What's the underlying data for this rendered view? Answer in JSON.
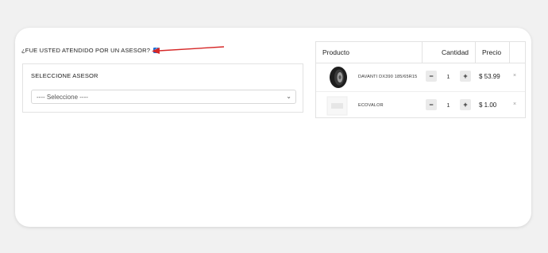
{
  "question": {
    "label": "¿FUE USTED ATENDIDO POR UN ASESOR?",
    "checked": true
  },
  "advisor": {
    "label": "SELECCIONE ASESOR",
    "select_value": "---- Seleccione ----"
  },
  "cart": {
    "headers": {
      "product": "Producto",
      "quantity": "Cantidad",
      "price": "Precio"
    },
    "items": [
      {
        "name": "DAVANTI DX390 185/65R15",
        "quantity": "1",
        "price": "$ 53.99",
        "minus": "−",
        "plus": "+",
        "remove": "×",
        "thumb_icon": "tire-icon"
      },
      {
        "name": "ECOVALOR",
        "quantity": "1",
        "price": "$ 1.00",
        "minus": "−",
        "plus": "+",
        "remove": "×",
        "thumb_icon": "product-placeholder-icon"
      }
    ]
  },
  "colors": {
    "checkbox": "#1f6fd6",
    "arrow": "#d62828",
    "background": "#f1f1f1"
  }
}
